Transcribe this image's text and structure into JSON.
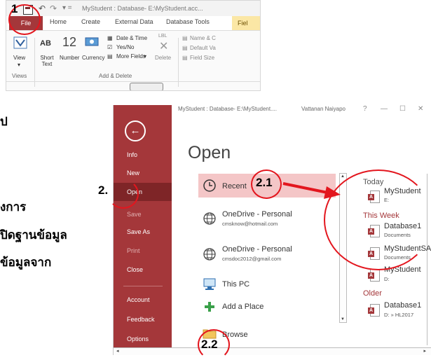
{
  "ribbon": {
    "window_title": "MyStudent : Database- E:\\MyStudent.acc...",
    "tabs": [
      "File",
      "Home",
      "Create",
      "External Data",
      "Database Tools",
      "Fiel"
    ],
    "buttons": {
      "view": "View",
      "ab": "AB",
      "short_text": "Short Text",
      "number_big": "12",
      "number": "Number",
      "currency": "Currency",
      "date_time": "Date & Time",
      "yes_no": "Yes/No",
      "more_fields": "More Fields",
      "delete": "Delete",
      "name_caption": "Name & C",
      "default_value": "Default Va",
      "field_size": "Field Size"
    },
    "groups": {
      "views": "Views",
      "add_delete": "Add & Delete"
    }
  },
  "annotations": {
    "step1": "1",
    "step2": "2.",
    "step21": "2.1",
    "step22": "2.2"
  },
  "thai_lines": [
    "ป",
    "งการ",
    "ปิดฐานข้อมูล",
    "ข้อมูลจาก"
  ],
  "backstage": {
    "titlebar": "MyStudent : Database- E:\\MyStudent....",
    "user": "Vattanan Naiyapo",
    "help": "?",
    "heading": "Open",
    "sidebar": [
      "Info",
      "New",
      "Open",
      "Save",
      "Save As",
      "Print",
      "Close",
      "Account",
      "Feedback",
      "Options"
    ],
    "options": {
      "recent": "Recent",
      "onedrive1": "OneDrive - Personal",
      "onedrive1_email": "cmsknow@hotmail.com",
      "onedrive2": "OneDrive - Personal",
      "onedrive2_email": "cmsdoc2012@gmail.com",
      "this_pc": "This PC",
      "add_place": "Add a Place",
      "browse": "Browse"
    },
    "recent_sections": {
      "today": "Today",
      "this_week": "This Week",
      "older": "Older"
    },
    "recent_files": [
      {
        "name": "MyStudent",
        "path": "E:"
      },
      {
        "name": "Database1",
        "path": "Documents"
      },
      {
        "name": "MyStudentSA",
        "path": "Documents"
      },
      {
        "name": "MyStudent",
        "path": "D:"
      },
      {
        "name": "Database1",
        "path": "D: » HL2017"
      }
    ],
    "accent_color": "#a4373a"
  }
}
